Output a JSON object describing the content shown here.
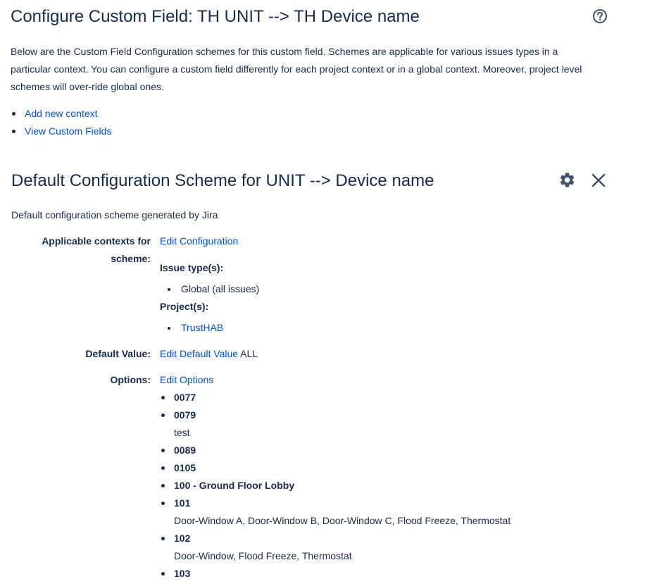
{
  "page": {
    "title": "Configure Custom Field: TH UNIT --> TH Device name",
    "description": "Below are the Custom Field Configuration schemes for this custom field. Schemes are applicable for various issues types in a particular context. You can configure a custom field differently for each project context or in a global context. Moreover, project level schemes will over-ride global ones.",
    "links": [
      {
        "label": "Add new context"
      },
      {
        "label": "View Custom Fields"
      }
    ]
  },
  "scheme": {
    "title": "Default Configuration Scheme for UNIT --> Device name",
    "description": "Default configuration scheme generated by Jira",
    "contexts": {
      "label_line1": "Applicable contexts for",
      "label_line2": "scheme:",
      "edit_link": "Edit Configuration",
      "issue_types_label": "Issue type(s):",
      "issue_types": [
        "Global (all issues)"
      ],
      "projects_label": "Project(s):",
      "projects": [
        "TrustHAB"
      ]
    },
    "default_value": {
      "label": "Default Value:",
      "edit_link": "Edit Default Value",
      "value": "ALL"
    },
    "options": {
      "label": "Options:",
      "edit_link": "Edit Options",
      "items": [
        {
          "name": "0077",
          "desc": ""
        },
        {
          "name": "0079",
          "desc": "test"
        },
        {
          "name": "0089",
          "desc": ""
        },
        {
          "name": "0105",
          "desc": ""
        },
        {
          "name": "100 - Ground Floor Lobby",
          "desc": ""
        },
        {
          "name": "101",
          "desc": "Door-Window A, Door-Window B, Door-Window C, Flood Freeze, Thermostat"
        },
        {
          "name": "102",
          "desc": "Door-Window, Flood Freeze, Thermostat"
        },
        {
          "name": "103",
          "desc": ""
        }
      ]
    }
  },
  "icons": {
    "help": "help-icon",
    "gear": "gear-icon",
    "close": "close-icon"
  },
  "colors": {
    "text": "#172b4d",
    "link": "#0052cc",
    "icon": "#42526e"
  }
}
